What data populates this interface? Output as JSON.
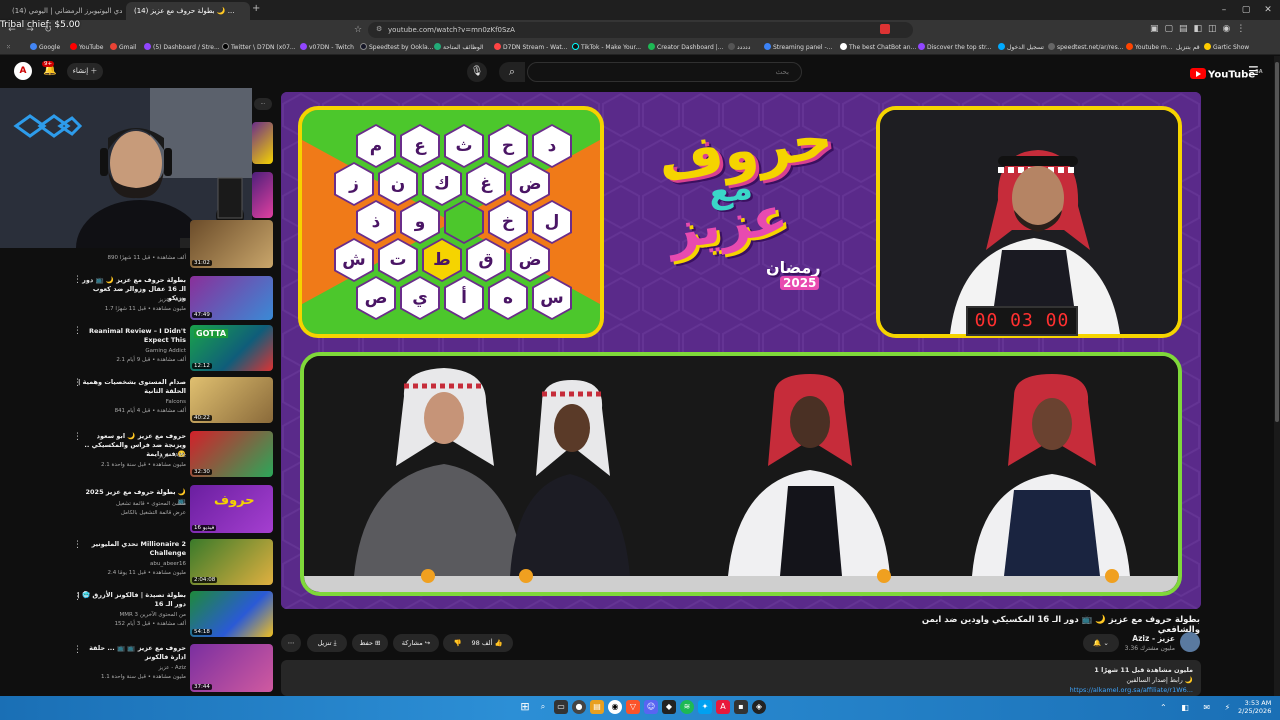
{
  "overlay_title": "Tribal chief: $5.00",
  "browser": {
    "tabs": [
      {
        "label": "(14) تحدي اليوتيوبرز الرمضاني | اليومي..."
      },
      {
        "label": "(14) بطولة حروف مع عزيز 🌙 ..."
      }
    ],
    "url": "youtube.com/watch?v=mn0zKf0SzA",
    "bookmarks": [
      "Google",
      "YouTube",
      "Gmail",
      "(5) Dashboard / Stre...",
      "Twitter \\ D7DN (x07...",
      "v07DN - Twitch",
      "Speedtest by Ookla...",
      "الوظائف المتاحة",
      "D7DN Stream - Wat...",
      "TikTok - Make Your...",
      "Creator Dashboard |...",
      "ددددد",
      "Streaming panel -...",
      "The best ChatBot an...",
      "Discover the top str...",
      "تسجيل الدخول",
      "speedtest.net/ar/res...",
      "Youtube m...",
      "قم بتنزيل",
      "Gartic Show"
    ]
  },
  "youtube": {
    "logo": "YouTube",
    "logo_region": "SA",
    "search_placeholder": "بحث",
    "create_label": "إنشاء",
    "notif_count": "9+"
  },
  "player": {
    "logo_main": "حروف",
    "logo_mid": "مع",
    "logo_name": "عزيز",
    "logo_sub": "رمضان",
    "logo_year": "2025",
    "timer": "00 03 00",
    "grid": [
      [
        "د",
        "ح",
        "ث",
        "ع",
        "م"
      ],
      [
        "ض",
        "غ",
        "ك",
        "ن",
        "ز"
      ],
      [
        "ل",
        "خ",
        "",
        "و",
        "ذ"
      ],
      [
        "ض",
        "ق",
        "ط",
        "ت",
        "ش"
      ],
      [
        "س",
        "ه",
        "أ",
        "ي",
        "ص"
      ]
    ]
  },
  "video": {
    "title": "بطولة حروف مع عزيز 🌙 📺 دور الـ 16 المكسيكي واودين ضد ايمن والشافعي",
    "channel": "Aziz - عزيز",
    "subs": "3.36 مليون مشترك",
    "likes": "98 ألف",
    "share": "مشاركة",
    "save": "حفظ",
    "download": "تنزيل",
    "description_line1": "1 مليون مشاهدة  قبل 11 شهرًا",
    "description_line2": "رابط إصدار السالفين 🌙",
    "description_link": "https://alkamel.org.sa/affiliate/r1W6..."
  },
  "sidebar_videos": [
    {
      "title": "",
      "channel": "",
      "meta": "890 ألف مشاهدة • قبل 11 شهرًا",
      "duration": "31:02"
    },
    {
      "title": "بطولة حروف مع عزيز 🌙 📺 دور الـ 16 عقال وزوالر ضد كعوب وزيكو",
      "channel": "عزيز - Aziz",
      "meta": "1.7 مليون مشاهدة • قبل 11 شهرًا",
      "duration": "47:49"
    },
    {
      "title": "Reanimal Review – I Didn't Expect This",
      "channel": "Gaming Addict",
      "meta": "2.1 ألف مشاهدة • قبل 9 أيام",
      "duration": "12:12"
    },
    {
      "title": "صدام المستوى بشخصيات وهمية | الحلقة الثانية",
      "channel": "Falcons",
      "meta": "841 ألف مشاهدة • قبل 4 أيام",
      "duration": "40:22"
    },
    {
      "title": "حروف مع عزيز 🌙 ابو سعود ويزنجة ضد فراس والمكسيكي .. فنه دايمة 🥺",
      "channel": "عزيز - Aziz",
      "meta": "2.1 مليون مشاهدة • قبل سنة واحدة",
      "duration": "32:30"
    },
    {
      "title": "بطولة حروف مع عزيز 2025 🌙 📺",
      "channel": "منشئ المحتوى • قائمة تشغيل",
      "meta": "عرض قائمة التشغيل بالكامل",
      "duration": "16 فيديو"
    },
    {
      "title": "تحدي المليونير Millionaire 2 Challenge",
      "channel": "abu_abeer16",
      "meta": "2.4 مليون مشاهدة • قبل 11 يومًا",
      "duration": "2:04:08"
    },
    {
      "title": "بطولة تصيدة | فالكونز الأزرق 🥶 | دور الـ 16",
      "channel": "MMR 3 من المحتوى الآخرين",
      "meta": "152 ألف مشاهدة • قبل 3 أيام",
      "duration": "54:18"
    },
    {
      "title": "حروف مع عزيز 📺 📺 ... حلقة ادارة فالكونز",
      "channel": "عزيز - Aziz",
      "meta": "1.1 مليون مشاهدة • قبل سنة واحدة",
      "duration": "37:44"
    }
  ],
  "taskbar": {
    "time": "3:53 AM",
    "date": "2/25/2026"
  }
}
